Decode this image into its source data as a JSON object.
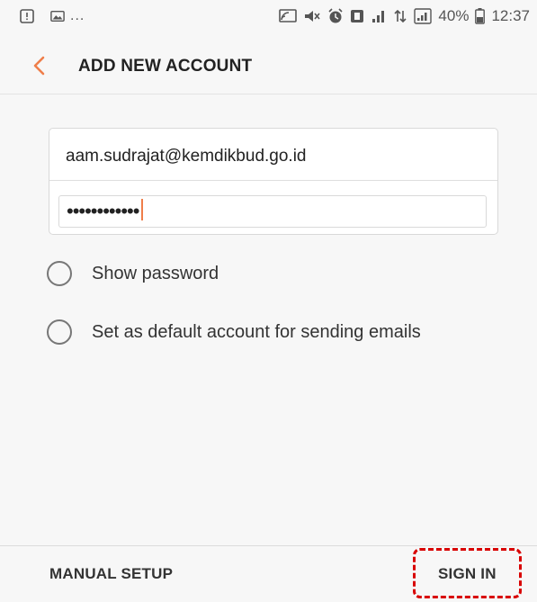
{
  "status_bar": {
    "battery_percent": "40%",
    "time": "12:37",
    "overflow_indicator": "..."
  },
  "app_bar": {
    "title": "ADD NEW ACCOUNT",
    "back_icon": "chevron-left-icon",
    "accent_color": "#ef7e4a"
  },
  "form": {
    "email_value": "aam.sudrajat@kemdikbud.go.id",
    "password_masked": "••••••••••••"
  },
  "options": [
    {
      "label": "Show password",
      "checked": false
    },
    {
      "label": "Set as default account for sending emails",
      "checked": false
    }
  ],
  "bottom_bar": {
    "manual_setup_label": "MANUAL SETUP",
    "sign_in_label": "SIGN IN",
    "highlight_color": "#d80000"
  }
}
